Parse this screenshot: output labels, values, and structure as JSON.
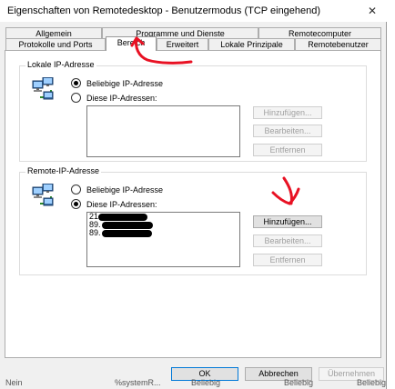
{
  "window": {
    "title": "Eigenschaften von Remotedesktop - Benutzermodus (TCP eingehend)",
    "close_glyph": "✕"
  },
  "tabs": {
    "row1": [
      "Allgemein",
      "Programme und Dienste",
      "Remotecomputer"
    ],
    "row2": [
      "Protokolle und Ports",
      "Bereich",
      "Erweitert",
      "Lokale Prinzipale",
      "Remotebenutzer"
    ],
    "active": "Bereich"
  },
  "local": {
    "legend": "Lokale IP-Adresse",
    "any_label": "Beliebige IP-Adresse",
    "these_label": "Diese IP-Adressen:",
    "selected": "any",
    "buttons": {
      "add": "Hinzufügen...",
      "edit": "Bearbeiten...",
      "remove": "Entfernen"
    }
  },
  "remote": {
    "legend": "Remote-IP-Adresse",
    "any_label": "Beliebige IP-Adresse",
    "these_label": "Diese IP-Adressen:",
    "selected": "these",
    "entries": [
      "21",
      "89.",
      "89."
    ],
    "buttons": {
      "add": "Hinzufügen...",
      "edit": "Bearbeiten...",
      "remove": "Entfernen"
    }
  },
  "footer": {
    "ok": "OK",
    "cancel": "Abbrechen",
    "apply": "Übernehmen"
  },
  "background_row": [
    "Nein",
    "%systemR...",
    "Beliebig",
    "Beliebig",
    "Beliebig"
  ],
  "colors": {
    "annotation": "#e81123",
    "accent": "#0078d7"
  },
  "icons": [
    "network-computers-icon",
    "close-icon"
  ]
}
